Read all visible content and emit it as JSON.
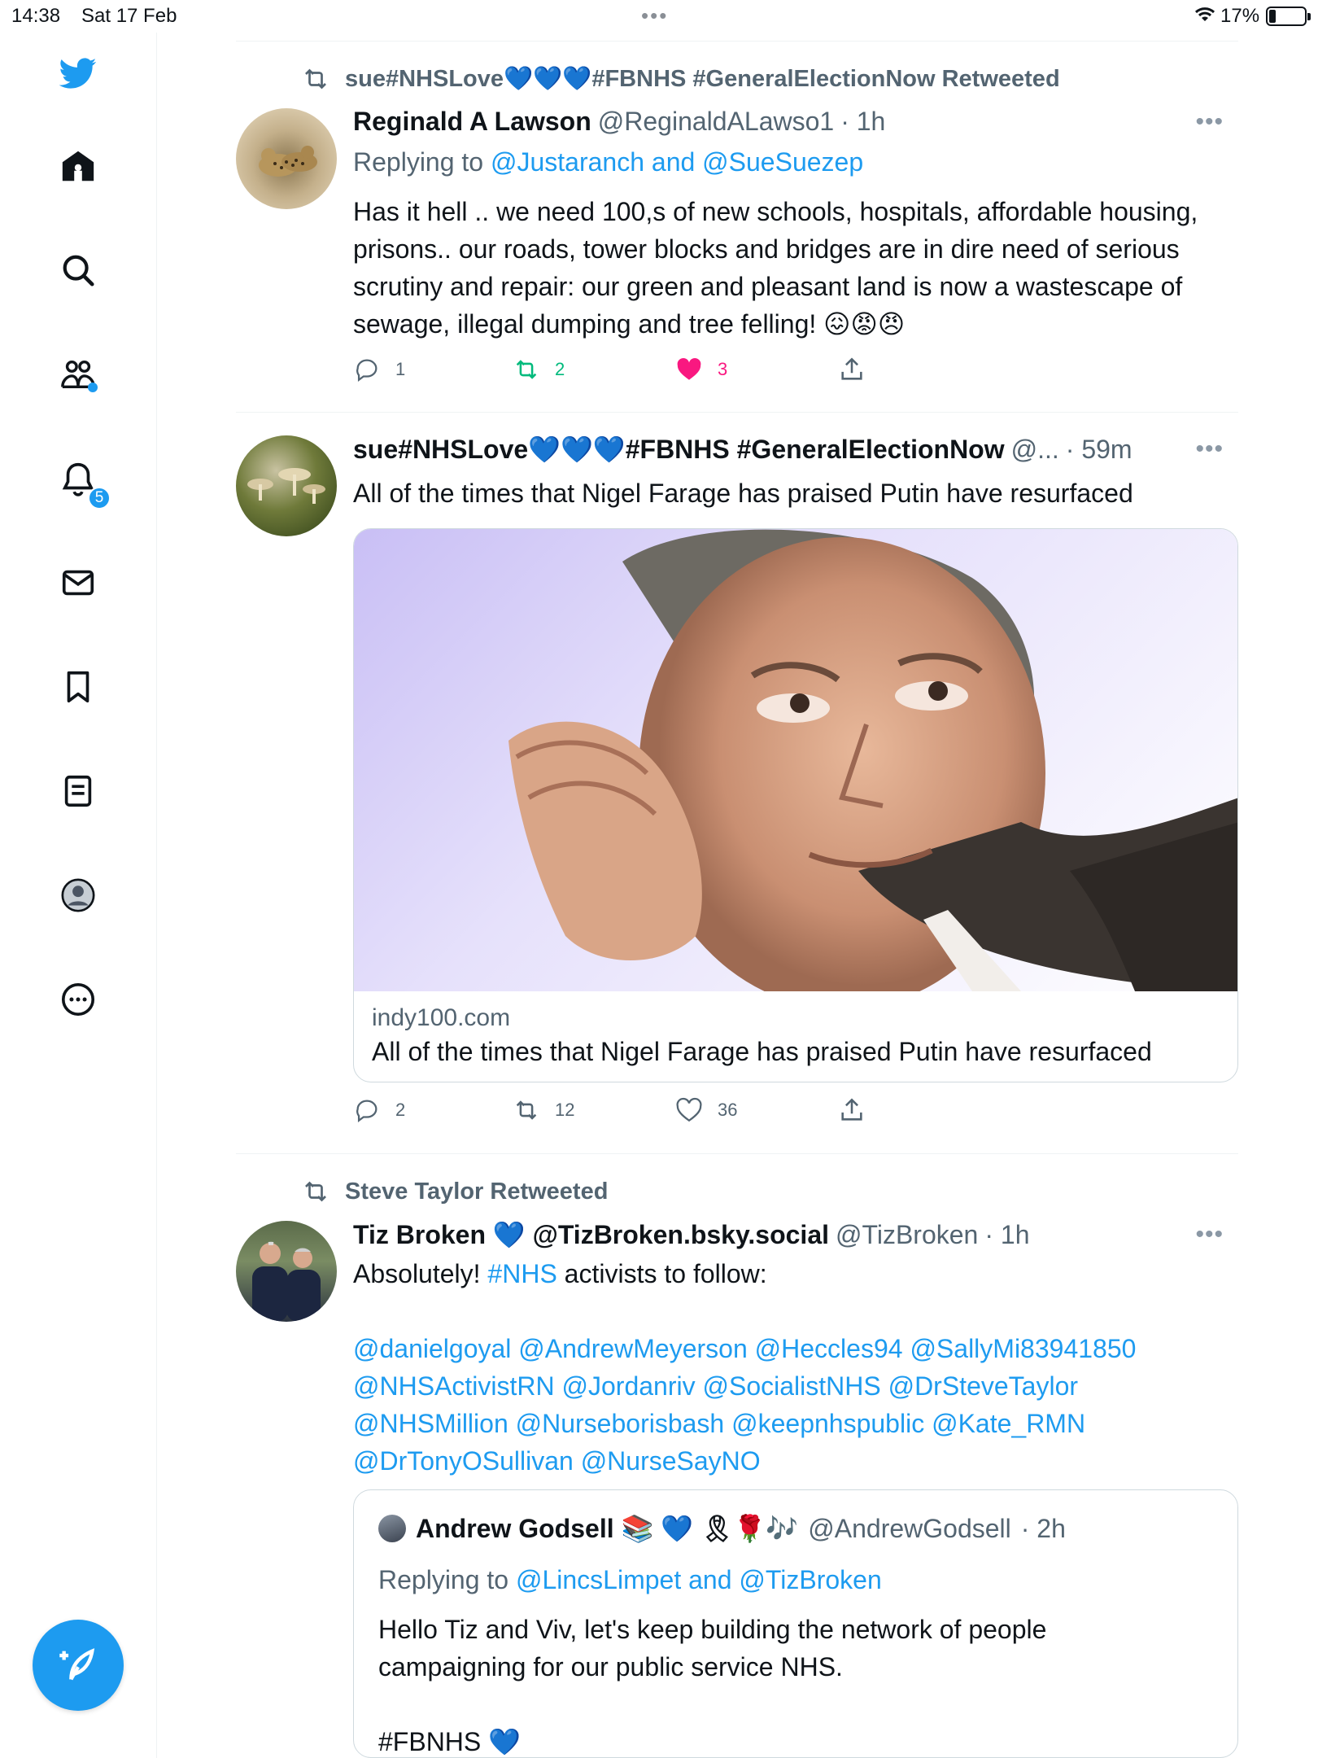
{
  "status_bar": {
    "time": "14:38",
    "date": "Sat 17 Feb",
    "battery": "17%"
  },
  "sidebar": {
    "notifications_count": "5",
    "icons": [
      "twitter-bird-icon",
      "home-icon",
      "search-icon",
      "communities-icon",
      "notifications-icon",
      "messages-icon",
      "bookmarks-icon",
      "lists-icon",
      "profile-icon",
      "more-icon",
      "compose-icon"
    ]
  },
  "tweets": [
    {
      "retweeted_by": "sue#NHSLove💙💙💙#FBNHS #GeneralElectionNow Retweeted",
      "name": "Reginald A Lawson",
      "handle": "@ReginaldALawso1",
      "time": "· 1h",
      "replying_prefix": "Replying to ",
      "replying_to": "@Justaranch and @SueSuezep",
      "text": "Has it hell .. we need 100,s of new schools, hospitals, affordable housing, prisons.. our roads, tower blocks and bridges are in dire need of serious scrutiny and repair: our green and pleasant land is now a wastescape of sewage, illegal dumping and tree felling! 😖😡😠",
      "replies": "1",
      "retweets": "2",
      "likes": "3"
    },
    {
      "name": "sue#NHSLove💙💙💙#FBNHS #GeneralElectionNow",
      "handle": "@...",
      "time": "· 59m",
      "text": "All of the times that Nigel Farage has praised Putin have resurfaced",
      "card_domain": "indy100.com",
      "card_title": "All of the times that Nigel Farage has praised Putin have resurfaced",
      "replies": "2",
      "retweets": "12",
      "likes": "36"
    },
    {
      "retweeted_by": "Steve Taylor Retweeted",
      "name": "Tiz Broken 💙 @TizBroken.bsky.social",
      "handle": "@TizBroken",
      "time": "· 1h",
      "text_prefix": "Absolutely! ",
      "hashtag": "#NHS",
      "text_suffix": " activists to follow:",
      "mentions_line1": "@danielgoyal @AndrewMeyerson @Heccles94 @SallyMi83941850",
      "mentions_line2": "@NHSActivistRN @Jordanriv @SocialistNHS @DrSteveTaylor",
      "mentions_line3": "@NHSMillion @Nurseborisbash @keepnhspublic @Kate_RMN",
      "mentions_line4": "@DrTonyOSullivan @NurseSayNO",
      "quote": {
        "name": "Andrew Godsell 📚 💙 🎗🌹🎶",
        "handle": "@AndrewGodsell",
        "time": "· 2h",
        "replying_prefix": "Replying to ",
        "replying_to": "@LincsLimpet and @TizBroken",
        "text": "Hello Tiz and Viv, let's keep building the network of people campaigning for our public service NHS.",
        "tag": "#FBNHS 💙"
      }
    }
  ],
  "colors": {
    "accent": "#1d9bf0",
    "like": "#f91880",
    "retweet": "#00ba7c",
    "muted": "#536471"
  }
}
